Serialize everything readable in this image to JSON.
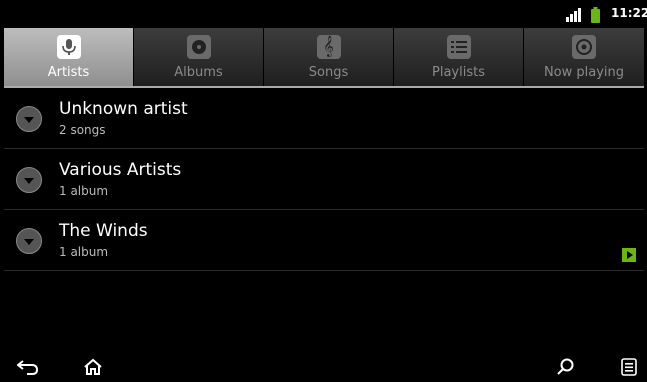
{
  "status_bar": {
    "time": "11:22",
    "signal_icon": "signal-bars-icon",
    "battery_icon": "battery-icon",
    "battery_color": "#6bb516"
  },
  "tabs": [
    {
      "label": "Artists",
      "icon": "microphone-icon",
      "active": true
    },
    {
      "label": "Albums",
      "icon": "disc-icon",
      "active": false
    },
    {
      "label": "Songs",
      "icon": "treble-clef-icon",
      "active": false
    },
    {
      "label": "Playlists",
      "icon": "list-icon",
      "active": false
    },
    {
      "label": "Now playing",
      "icon": "now-playing-icon",
      "active": false
    }
  ],
  "artists": [
    {
      "name": "Unknown artist",
      "detail": "2 songs",
      "playing": false
    },
    {
      "name": "Various Artists",
      "detail": "1 album",
      "playing": false
    },
    {
      "name": "The Winds",
      "detail": "1 album",
      "playing": true
    }
  ],
  "nav": {
    "back_icon": "back-arrow-icon",
    "home_icon": "home-icon",
    "search_icon": "search-icon",
    "menu_icon": "menu-icon"
  },
  "colors": {
    "accent_playing": "#6bb516",
    "active_tab": "#a6a6a6"
  }
}
